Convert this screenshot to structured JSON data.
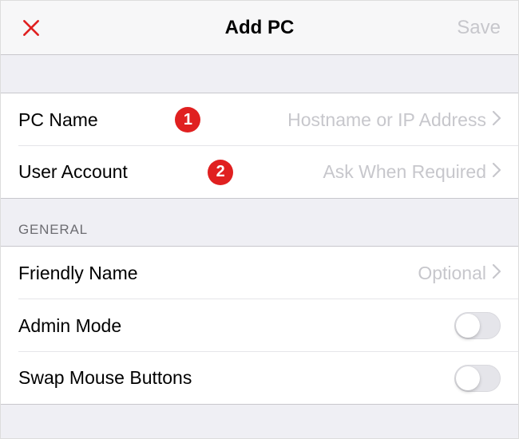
{
  "header": {
    "title": "Add PC",
    "save_label": "Save"
  },
  "topGroup": {
    "pcName": {
      "label": "PC Name",
      "placeholder": "Hostname or IP Address",
      "badge": "1"
    },
    "userAccount": {
      "label": "User Account",
      "value": "Ask When Required",
      "badge": "2"
    }
  },
  "general": {
    "header": "GENERAL",
    "friendlyName": {
      "label": "Friendly Name",
      "placeholder": "Optional"
    },
    "adminMode": {
      "label": "Admin Mode",
      "on": false
    },
    "swapMouseButtons": {
      "label": "Swap Mouse Buttons",
      "on": false
    }
  }
}
